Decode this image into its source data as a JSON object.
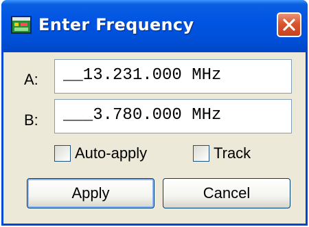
{
  "window": {
    "title": "Enter Frequency",
    "icon": "frequency-app-icon",
    "close_icon": "close-icon"
  },
  "fields": {
    "a": {
      "label": "A:",
      "value": "__13.231.000 MHz"
    },
    "b": {
      "label": "B:",
      "value": "___3.780.000 MHz"
    }
  },
  "options": {
    "auto_apply": {
      "label": "Auto-apply",
      "checked": false
    },
    "track": {
      "label": "Track",
      "checked": false
    }
  },
  "buttons": {
    "apply": "Apply",
    "cancel": "Cancel"
  },
  "colors": {
    "titlebar": "#0054e3",
    "face": "#ece9d8",
    "close": "#d8552f"
  }
}
